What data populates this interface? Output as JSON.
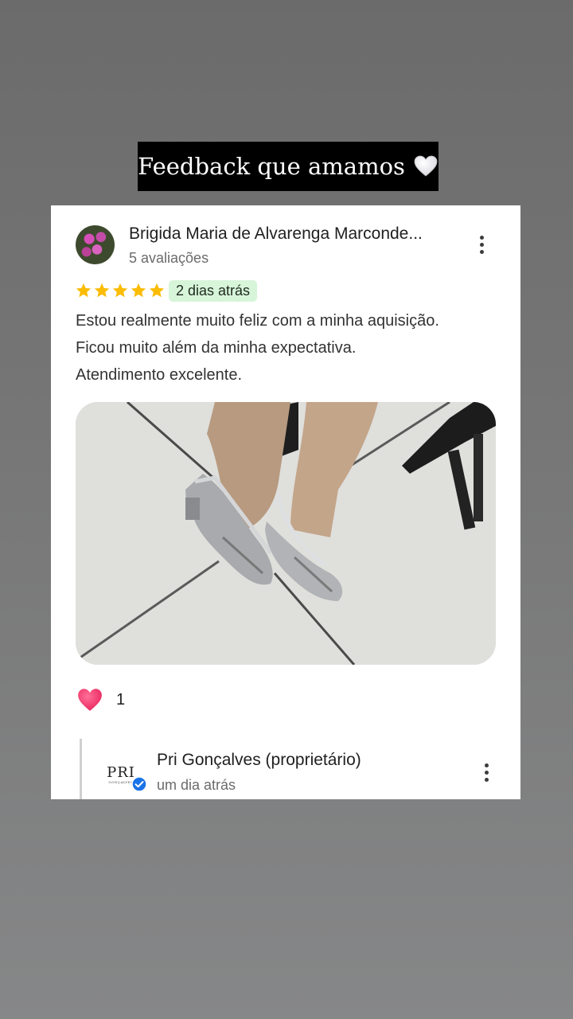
{
  "story": {
    "title": "Feedback que amamos",
    "title_icon": "white-heart-icon"
  },
  "review": {
    "reviewer_name": "Brigida Maria de Alvarenga Marconde...",
    "review_count": "5 avaliações",
    "rating": 5,
    "rating_max": 5,
    "date": "2 dias atrás",
    "text_lines": [
      "Estou realmente muito feliz com a minha aquisição.",
      "Ficou muito além da minha expectativa.",
      "Atendimento excelente."
    ],
    "photo_icon": "review-photo-silver-shoes",
    "reactions": {
      "icon": "heart-icon",
      "count": "1"
    }
  },
  "owner_reply": {
    "logo_text": "PRI",
    "logo_subtext": "GONÇALVES",
    "name": "Pri Gonçalves (proprietário)",
    "date": "um dia atrás"
  },
  "colors": {
    "star": "#fbbc04",
    "date_badge_bg": "#d7f5d9",
    "heart": "#e8265e",
    "verified": "#1a73e8"
  }
}
